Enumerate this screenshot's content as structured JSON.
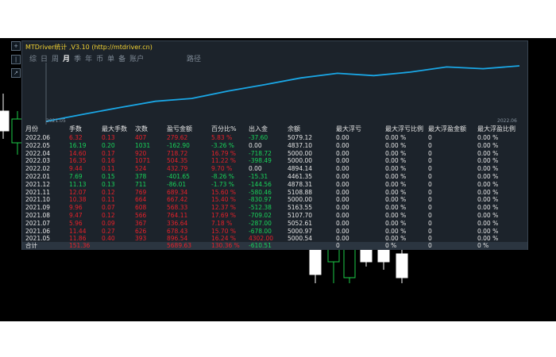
{
  "window": {
    "title": "MTDriver统计 ,V3.10 (http://mtdriver.cn)"
  },
  "tabs": [
    {
      "label": "综"
    },
    {
      "label": "日"
    },
    {
      "label": "周"
    },
    {
      "label": "月"
    },
    {
      "label": "季"
    },
    {
      "label": "年"
    },
    {
      "label": "币"
    },
    {
      "label": "单"
    },
    {
      "label": "备"
    },
    {
      "label": "账户"
    }
  ],
  "active_tab": "月",
  "path_label": "路径",
  "side_icons": [
    "+",
    "|",
    "↗"
  ],
  "equity_chart": {
    "start_label": "2021.05",
    "end_label": "2022.06",
    "line_color": "#1aa7e6",
    "values": [
      0,
      1.2,
      2.4,
      3.5,
      4.0,
      5.3,
      6.4,
      7.6,
      8.4,
      8.0,
      8.6,
      9.5,
      9.2,
      9.7
    ]
  },
  "table": {
    "headers": [
      "月份",
      "手数",
      "最大手数",
      "次数",
      "盈亏金额",
      "百分比%",
      "出入金",
      "余额",
      "最大浮亏",
      "最大浮亏比例",
      "最大浮盈金额",
      "最大浮盈比例"
    ],
    "rows": [
      {
        "cells": [
          "2022.06",
          "6.32",
          "0.13",
          "407",
          "279.62",
          "5.83 %",
          "-37.60",
          "5079.12",
          "0.00",
          "0.00 %",
          "0",
          "0.00 %"
        ],
        "sign": "pos"
      },
      {
        "cells": [
          "2022.05",
          "16.19",
          "0.20",
          "1031",
          "-162.90",
          "-3.26 %",
          "0.00",
          "4837.10",
          "0.00",
          "0.00 %",
          "0",
          "0.00 %"
        ],
        "sign": "neg"
      },
      {
        "cells": [
          "2022.04",
          "14.60",
          "0.17",
          "920",
          "718.72",
          "16.79 %",
          "-718.72",
          "5000.00",
          "0.00",
          "0.00 %",
          "0",
          "0.00 %"
        ],
        "sign": "pos"
      },
      {
        "cells": [
          "2022.03",
          "16.35",
          "0.16",
          "1071",
          "504.35",
          "11.22 %",
          "-398.49",
          "5000.00",
          "0.00",
          "0.00 %",
          "0",
          "0.00 %"
        ],
        "sign": "pos"
      },
      {
        "cells": [
          "2022.02",
          "9.44",
          "0.11",
          "524",
          "432.79",
          "9.70 %",
          "0.00",
          "4894.14",
          "0.00",
          "0.00 %",
          "0",
          "0.00 %"
        ],
        "sign": "pos"
      },
      {
        "cells": [
          "2022.01",
          "7.69",
          "0.15",
          "378",
          "-401.65",
          "-8.26 %",
          "-15.31",
          "4461.35",
          "0.00",
          "0.00 %",
          "0",
          "0.00 %"
        ],
        "sign": "neg"
      },
      {
        "cells": [
          "2021.12",
          "11.13",
          "0.13",
          "711",
          "-86.01",
          "-1.73 %",
          "-144.56",
          "4878.31",
          "0.00",
          "0.00 %",
          "0",
          "0.00 %"
        ],
        "sign": "neg"
      },
      {
        "cells": [
          "2021.11",
          "12.07",
          "0.12",
          "769",
          "689.34",
          "15.60 %",
          "-580.46",
          "5108.88",
          "0.00",
          "0.00 %",
          "0",
          "0.00 %"
        ],
        "sign": "pos"
      },
      {
        "cells": [
          "2021.10",
          "10.38",
          "0.11",
          "664",
          "667.42",
          "15.40 %",
          "-830.97",
          "5000.00",
          "0.00",
          "0.00 %",
          "0",
          "0.00 %"
        ],
        "sign": "pos"
      },
      {
        "cells": [
          "2021.09",
          "9.96",
          "0.07",
          "608",
          "568.33",
          "12.37 %",
          "-512.38",
          "5163.55",
          "0.00",
          "0.00 %",
          "0",
          "0.00 %"
        ],
        "sign": "pos"
      },
      {
        "cells": [
          "2021.08",
          "9.47",
          "0.12",
          "566",
          "764.11",
          "17.69 %",
          "-709.02",
          "5107.70",
          "0.00",
          "0.00 %",
          "0",
          "0.00 %"
        ],
        "sign": "pos"
      },
      {
        "cells": [
          "2021.07",
          "5.96",
          "0.09",
          "367",
          "336.64",
          "7.18 %",
          "-287.00",
          "5052.61",
          "0.00",
          "0.00 %",
          "0",
          "0.00 %"
        ],
        "sign": "pos"
      },
      {
        "cells": [
          "2021.06",
          "11.44",
          "0.27",
          "626",
          "678.43",
          "15.70 %",
          "-678.00",
          "5000.97",
          "0.00",
          "0.00 %",
          "0",
          "0.00 %"
        ],
        "sign": "pos"
      },
      {
        "cells": [
          "2021.05",
          "11.86",
          "0.40",
          "393",
          "896.54",
          "16.24 %",
          "4302.00",
          "5000.54",
          "0.00",
          "0.00 %",
          "0",
          "0.00 %"
        ],
        "sign": "pos"
      }
    ],
    "total": {
      "label": "合计",
      "lots": "151.36",
      "profit": "5689.63",
      "pct": "130.36 %",
      "flow": "-610.51",
      "c8": "0",
      "c9": "0 %",
      "c10": "0",
      "c11": "0 %"
    }
  },
  "colors": {
    "positive": "#e8212a",
    "negative": "#19d35a",
    "neutral": "#e6e6e6",
    "title": "#f2d232"
  }
}
